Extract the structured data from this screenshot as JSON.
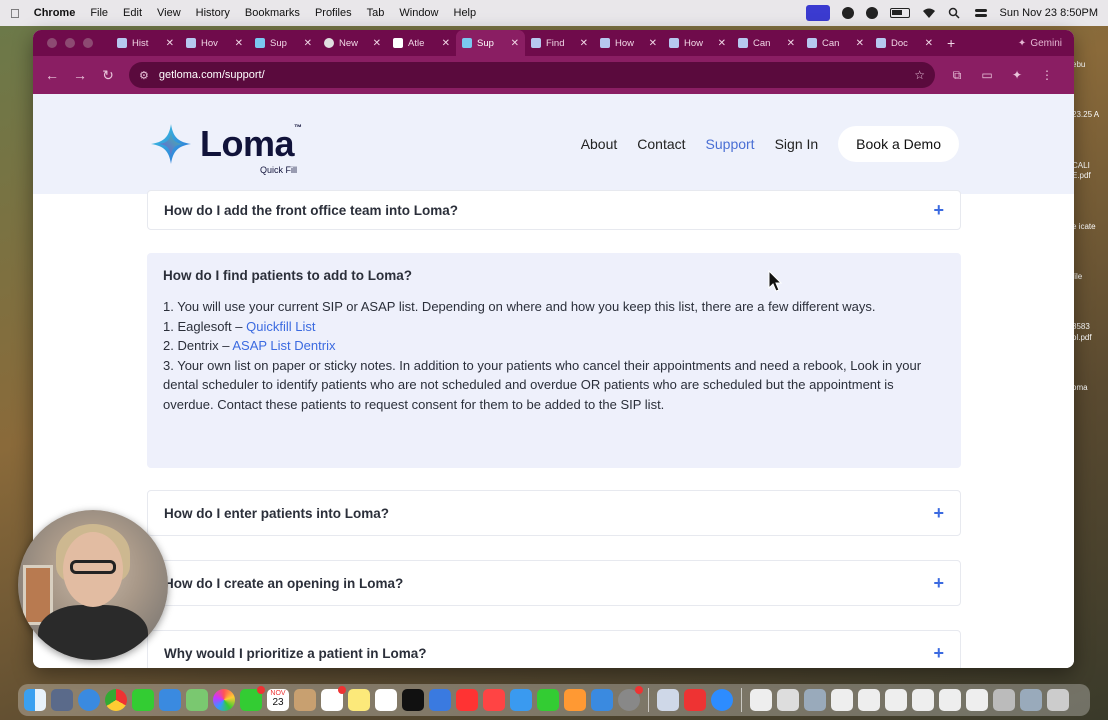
{
  "menubar": {
    "app": "Chrome",
    "items": [
      "File",
      "Edit",
      "View",
      "History",
      "Bookmarks",
      "Profiles",
      "Tab",
      "Window",
      "Help"
    ],
    "datetime": "Sun Nov 23  8:50PM"
  },
  "desktop_labels": [
    "ebu",
    "23.25 A",
    "CALI E.pdf",
    "e icate",
    "file",
    "8583 ol.pdf",
    "oma"
  ],
  "tabs": [
    {
      "label": "Hist",
      "icon": "history-icon"
    },
    {
      "label": "Hov",
      "icon": "doc-icon"
    },
    {
      "label": "Sup",
      "icon": "loma-icon"
    },
    {
      "label": "New",
      "icon": "github-icon"
    },
    {
      "label": "Atle",
      "icon": "atlas-icon"
    },
    {
      "label": "Sup",
      "icon": "loma-icon",
      "active": true
    },
    {
      "label": "Find",
      "icon": "doc-icon"
    },
    {
      "label": "How",
      "icon": "doc-icon"
    },
    {
      "label": "How",
      "icon": "doc-icon"
    },
    {
      "label": "Can",
      "icon": "doc-icon"
    },
    {
      "label": "Can",
      "icon": "doc-icon"
    },
    {
      "label": "Doc",
      "icon": "doc-icon"
    }
  ],
  "gemini_label": "Gemini",
  "address_bar": {
    "url": "getloma.com/support/"
  },
  "site": {
    "logo_text": "Loma",
    "logo_tm": "™",
    "logo_sub": "Quick Fill",
    "nav": [
      "About",
      "Contact",
      "Support",
      "Sign In"
    ],
    "nav_active": "Support",
    "cta": "Book a Demo"
  },
  "faq": {
    "q_front_office": "How do I add the front office team into Loma?",
    "open": {
      "question": "How do I find patients to add to Loma?",
      "line1": "1. You will use your current SIP or ASAP list. Depending on where and how you keep this list, there are a few different ways.",
      "line2_prefix": "1. Eaglesoft – ",
      "line2_link": "Quickfill List",
      "line3_prefix": "2. Dentrix – ",
      "line3_link": "ASAP List Dentrix",
      "line4": "3. Your own list on paper or sticky notes. In addition to your patients who cancel their appointments and need a rebook, Look in your dental scheduler to identify patients who are not scheduled and overdue OR patients who are scheduled but the appointment is overdue. Contact these patients to request consent for them to be added to the SIP list."
    },
    "q_enter": "How do I enter patients into Loma?",
    "q_opening": "How do I create an opening in Loma?",
    "q_prioritize": "Why would I prioritize a patient in Loma?"
  },
  "dock": {
    "calendar_month": "NOV",
    "calendar_day": "23"
  }
}
